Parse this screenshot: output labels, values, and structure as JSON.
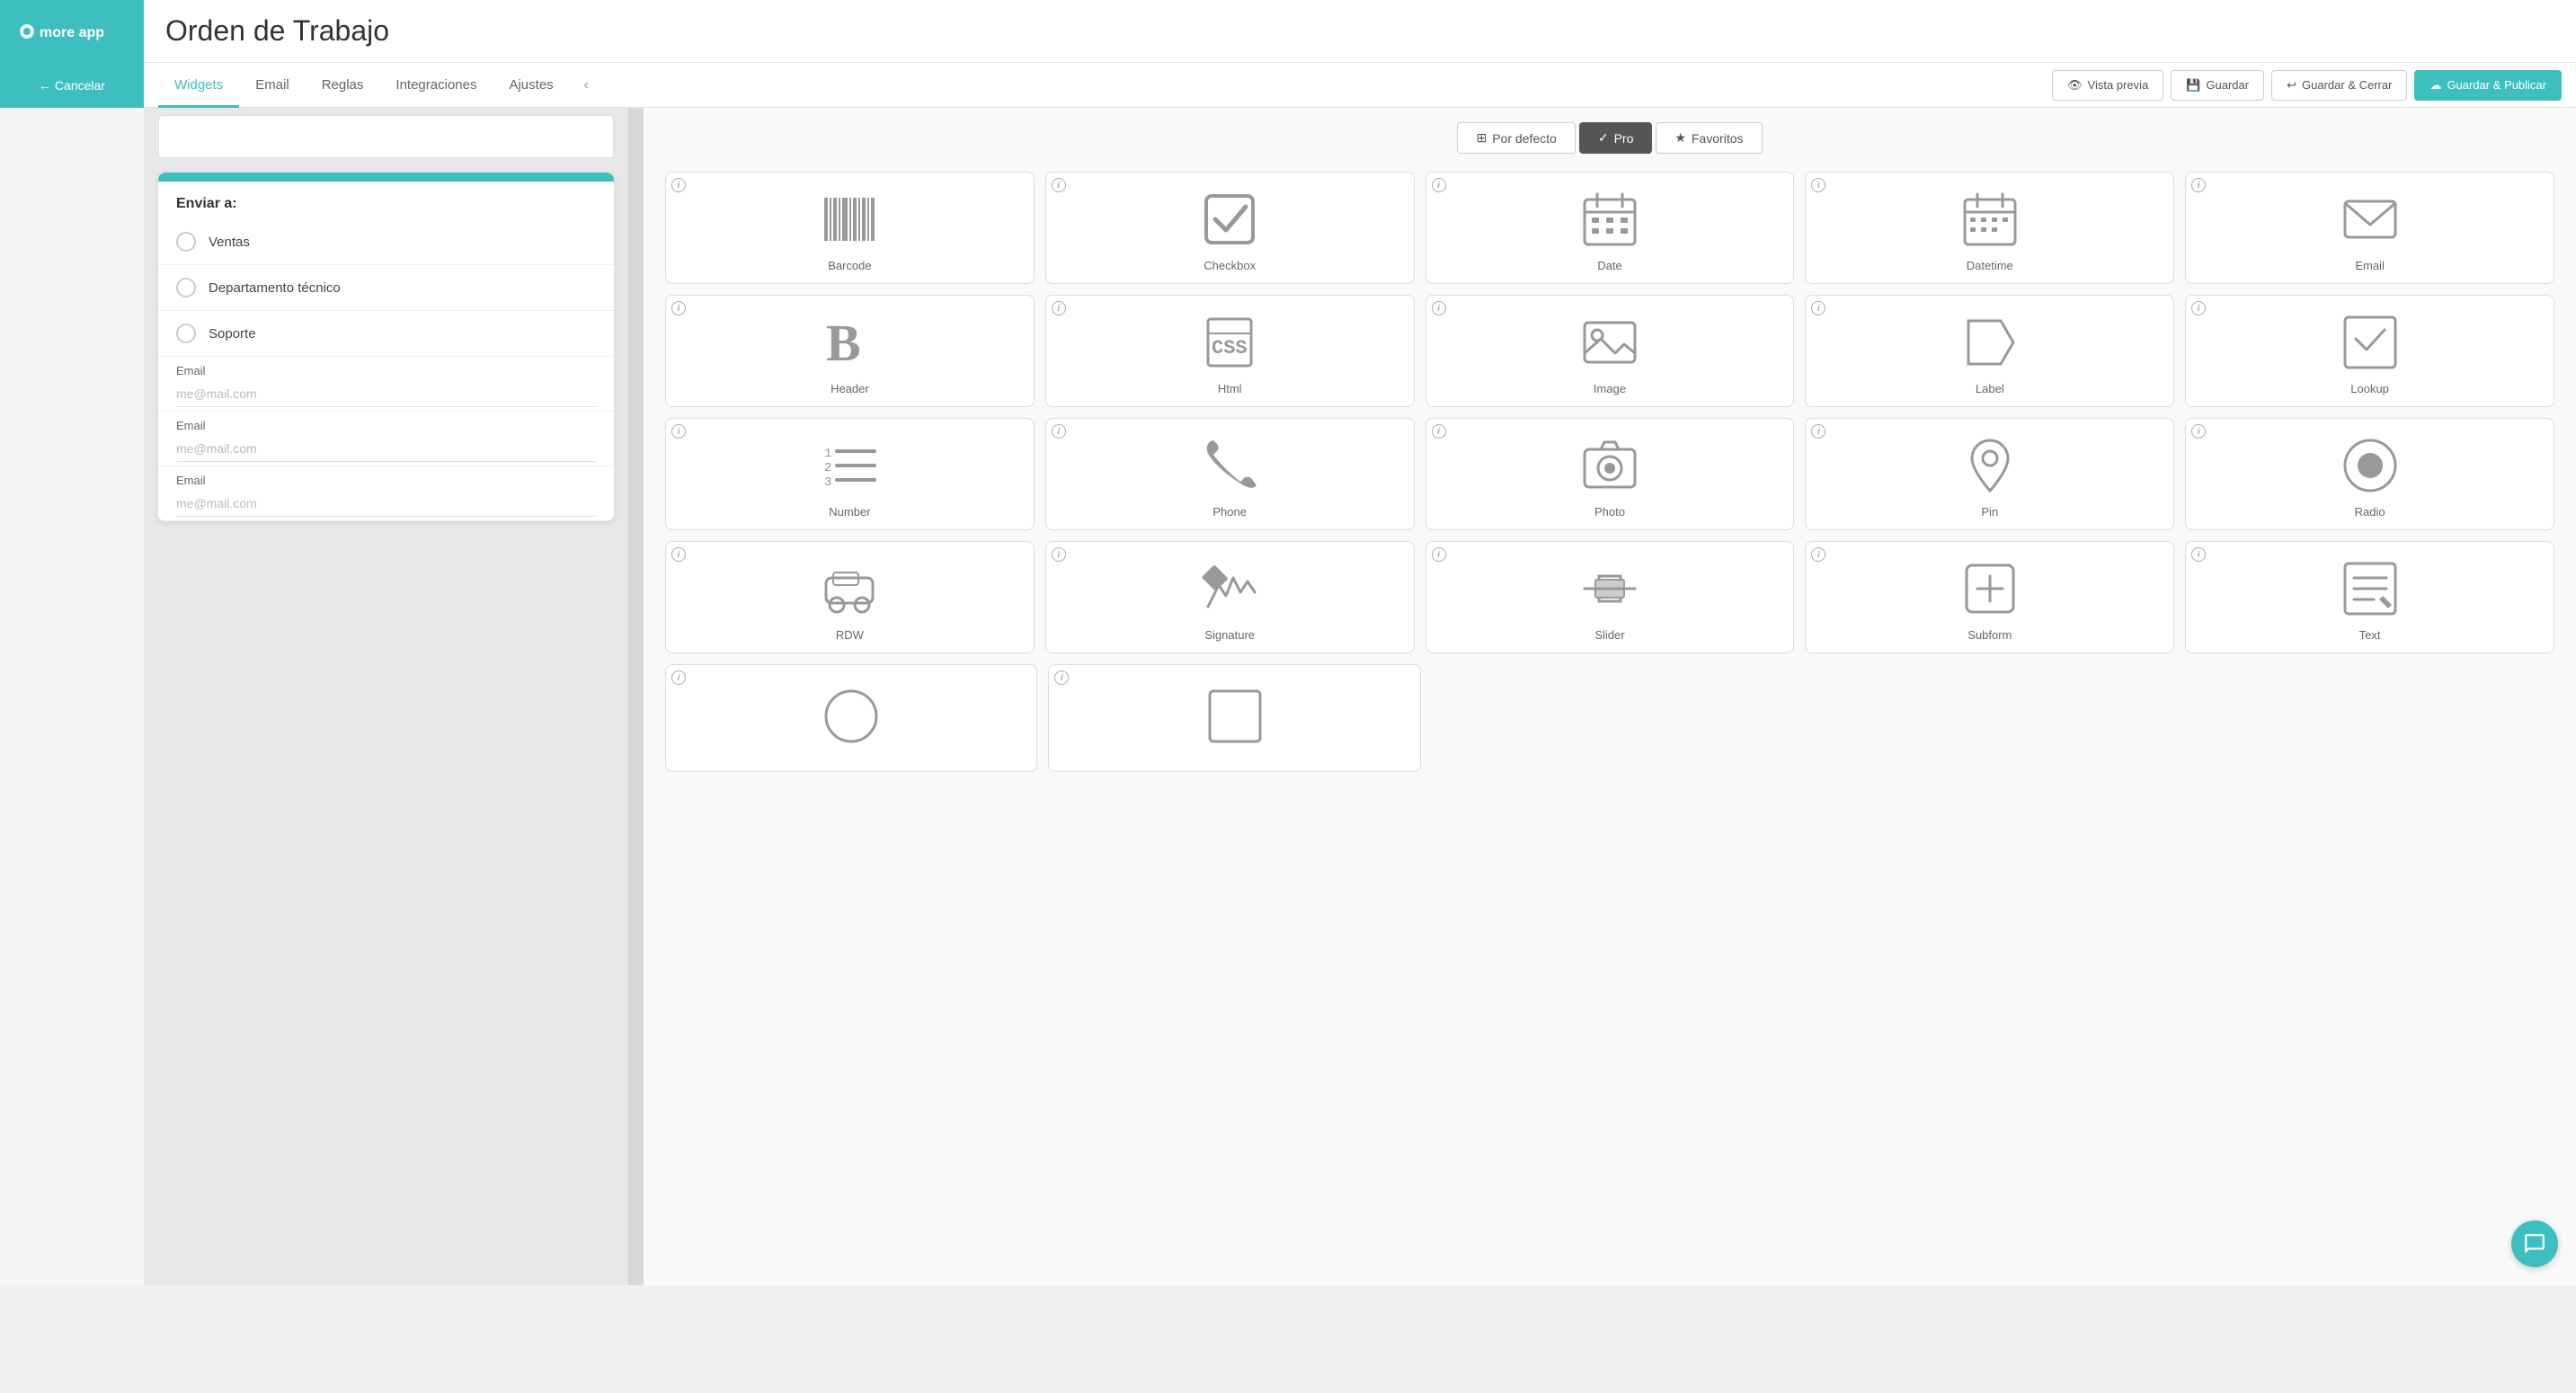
{
  "header": {
    "logo": "more app",
    "title": "Orden de Trabajo"
  },
  "nav": {
    "tabs": [
      {
        "id": "widgets",
        "label": "Widgets",
        "active": true
      },
      {
        "id": "email",
        "label": "Email",
        "active": false
      },
      {
        "id": "reglas",
        "label": "Reglas",
        "active": false
      },
      {
        "id": "integraciones",
        "label": "Integraciones",
        "active": false
      },
      {
        "id": "ajustes",
        "label": "Ajustes",
        "active": false
      }
    ],
    "actions": {
      "preview": "Vista previa",
      "save": "Guardar",
      "save_close": "Guardar & Cerrar",
      "save_publish": "Guardar & Publicar"
    }
  },
  "sidebar": {
    "cancel_label": "← Cancelar"
  },
  "form_preview": {
    "section_label": "Enviar a:",
    "radio_items": [
      {
        "label": "Ventas"
      },
      {
        "label": "Departamento técnico"
      },
      {
        "label": "Soporte"
      }
    ],
    "email_fields": [
      {
        "label": "Email",
        "placeholder": "me@mail.com"
      },
      {
        "label": "Email",
        "placeholder": "me@mail.com"
      },
      {
        "label": "Email",
        "placeholder": "me@mail.com"
      }
    ]
  },
  "widget_panel": {
    "tabs": [
      {
        "id": "por_defecto",
        "label": "Por defecto",
        "active": false,
        "icon": "⊞"
      },
      {
        "id": "pro",
        "label": "Pro",
        "active": true,
        "icon": "✓"
      },
      {
        "id": "favoritos",
        "label": "Favoritos",
        "active": false,
        "icon": "★"
      }
    ],
    "widgets": [
      {
        "id": "barcode",
        "label": "Barcode"
      },
      {
        "id": "checkbox",
        "label": "Checkbox"
      },
      {
        "id": "date",
        "label": "Date"
      },
      {
        "id": "datetime",
        "label": "Datetime"
      },
      {
        "id": "email",
        "label": "Email"
      },
      {
        "id": "header",
        "label": "Header"
      },
      {
        "id": "html",
        "label": "Html"
      },
      {
        "id": "image",
        "label": "Image"
      },
      {
        "id": "label",
        "label": "Label"
      },
      {
        "id": "lookup",
        "label": "Lookup"
      },
      {
        "id": "number",
        "label": "Number"
      },
      {
        "id": "phone",
        "label": "Phone"
      },
      {
        "id": "photo",
        "label": "Photo"
      },
      {
        "id": "pin",
        "label": "Pin"
      },
      {
        "id": "radio",
        "label": "Radio"
      },
      {
        "id": "rdw",
        "label": "RDW"
      },
      {
        "id": "signature",
        "label": "Signature"
      },
      {
        "id": "slider",
        "label": "Slider"
      },
      {
        "id": "subform",
        "label": "Subform"
      },
      {
        "id": "text",
        "label": "Text"
      }
    ]
  }
}
